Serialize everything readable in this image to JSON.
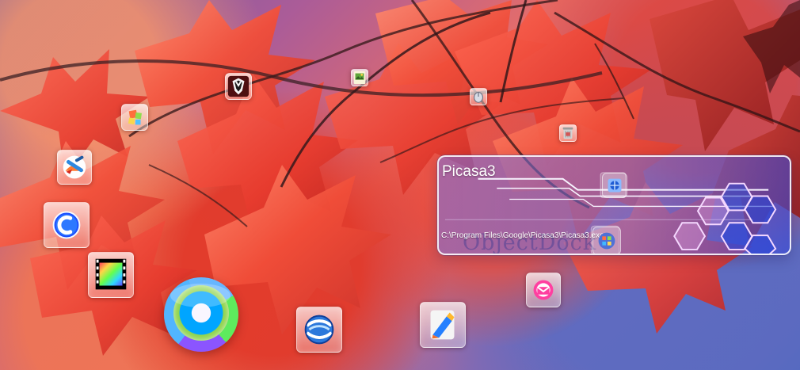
{
  "launcher_tooltip": {
    "title": "Picasa3",
    "path": "C:\\Program Files\\Google\\Picasa3\\Picasa3.exe",
    "watermark": "ObjectDock"
  },
  "icons": {
    "launcher": "launcher-icon",
    "mail": "mail-icon",
    "photo": "photo-icon",
    "mouse": "mouse-icon",
    "trash": "trash-icon",
    "cleaner": "cleaner-icon",
    "ccleaner": "ccleaner-icon",
    "film": "film-icon",
    "picasa": "picasa-icon",
    "earth": "google-earth-icon",
    "editor": "editor-icon",
    "tools": "tools-icon",
    "globe_small": "globe-icon",
    "windows": "windows-icon"
  },
  "colors": {
    "panel_blue": "#4e63df",
    "leaf_red": "#e1392a",
    "accent_white": "#ffffff"
  }
}
